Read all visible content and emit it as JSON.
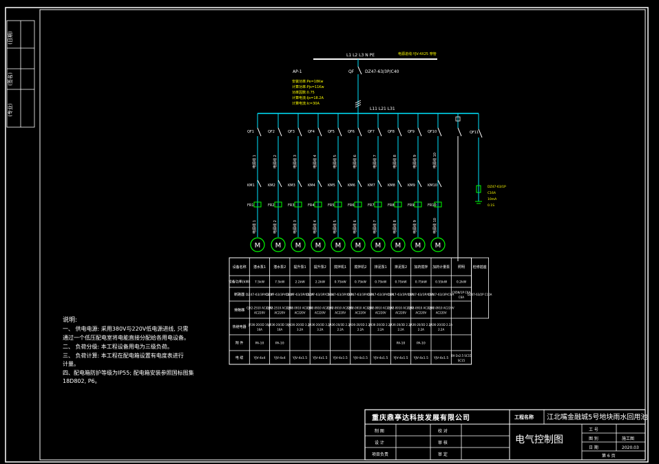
{
  "side_labels": [
    "(日期)",
    "(签名)",
    "(专业)"
  ],
  "bus": {
    "phases": "L1  L2  L3   N  PE",
    "incoming": "电源进线:YJV-4X25 穿管",
    "panel_id": "AP-1",
    "main_breaker_id": "QF",
    "main_breaker": "DZ47-63/3P/C40",
    "params": [
      "安装功率:Pe=18Kw",
      "计算功率:Pjs=11Kw",
      "功率因数:0.75",
      "计算电流:Ijs=18.2A",
      "计算电流:Ic=30A"
    ],
    "sub_phases": "L11  L21  L31"
  },
  "branches": {
    "breakers": [
      "QF1",
      "QF2",
      "QF3",
      "QF4",
      "QF5",
      "QF6",
      "QF7",
      "QF8",
      "QF9",
      "QF10",
      "",
      "QF11"
    ],
    "cables": [
      "电源线 1",
      "电源线 2",
      "电源线 3",
      "电源线 4",
      "电源线 5",
      "电源线 6",
      "电源线 7",
      "电源线 8",
      "电源线 9",
      "电源线 10"
    ],
    "contactors": [
      "KM1",
      "KM2",
      "KM3",
      "KM4",
      "KM5",
      "KM6",
      "KM7",
      "KM8",
      "KM9",
      "KM10"
    ],
    "relays": [
      "FR1",
      "FR2",
      "FR3",
      "FR4",
      "FR5",
      "FR6",
      "FR7",
      "FR8",
      "FR9",
      "FR10"
    ],
    "motor_cables": [
      "电源线 1",
      "电源线 2",
      "电源线 3",
      "电源线 4",
      "电源线 5",
      "电源线 6",
      "电源线 7",
      "电源线 8",
      "电源线 9",
      "电源线 10"
    ],
    "motor_symbol": "M",
    "spare_note": [
      "DZ47-63/1P",
      "C16A",
      "10mA",
      "0.1S"
    ]
  },
  "table": {
    "row_labels": [
      "设备名称",
      "设备功率(kW)",
      "断路器",
      "接触器",
      "热继电器",
      "附 件",
      "电 缆"
    ],
    "last_col_header": "检修插座",
    "columns": [
      {
        "name": "潜水泵1",
        "power": "7.5kW",
        "breaker": "DZ47-63/3P/C20A",
        "contactor": "CJX2-2510 AC220V",
        "relay": "JR36-20/3D 16A",
        "accessory": "PA-10",
        "cable": "YJV-4x4"
      },
      {
        "name": "潜水泵2",
        "power": "7.5kW",
        "breaker": "DZ47-63/3P/C20A",
        "contactor": "CJX2-2510 AC220V",
        "relay": "JR36-20/3D 16A",
        "accessory": "PA-10",
        "cable": "YJV-4x4"
      },
      {
        "name": "提升泵1",
        "power": "2.2kW",
        "breaker": "DZ47-63/3P/C10A",
        "contactor": "CJX2-0910 AC220V",
        "relay": "JR36-20/3D 3.2A",
        "accessory": "",
        "cable": "YJV-4x1.5"
      },
      {
        "name": "提升泵2",
        "power": "2.2kW",
        "breaker": "DZ47-63/3P/C10A",
        "contactor": "CJX2-0910 AC220V",
        "relay": "JR36-20/3D 3.2A",
        "accessory": "",
        "cable": "YJV-4x1.5"
      },
      {
        "name": "搅拌机1",
        "power": "0.75kW",
        "breaker": "DZ47-63/3P/C6A",
        "contactor": "CJX2-0910 AC220V",
        "relay": "JR36-20/3D 2.2A",
        "accessory": "",
        "cable": "YJV-4x1.5"
      },
      {
        "name": "搅拌机2",
        "power": "0.75kW",
        "breaker": "DZ47-63/3P/C6A",
        "contactor": "CJX2-0910 AC220V",
        "relay": "JR36-20/3D 2.2A",
        "accessory": "",
        "cable": "YJV-4x1.5"
      },
      {
        "name": "排泥泵1",
        "power": "0.75kW",
        "breaker": "DZ47-63/3P/C6A",
        "contactor": "CJX2-0910 AC220V",
        "relay": "JR36-20/3D 2.2A",
        "accessory": "",
        "cable": "YJV-4x1.5"
      },
      {
        "name": "排泥泵2",
        "power": "0.75kW",
        "breaker": "DZ47-63/3P/C6A",
        "contactor": "CJX2-0910 AC220V",
        "relay": "JR36-20/3D 2.2A",
        "accessory": "PA-10",
        "cable": "YJV-4x1.5"
      },
      {
        "name": "加药搅拌",
        "power": "0.75kW",
        "breaker": "DZ47-63/3P/C6A",
        "contactor": "CJX2-0910 AC220V",
        "relay": "JR36-20/3D 2.2A",
        "accessory": "PA-10",
        "cable": "YJV-4x1.5"
      },
      {
        "name": "加药计量泵",
        "power": "0.55kW",
        "breaker": "DZ47-63/3P/C6A",
        "contactor": "CJX2-0910 AC220V",
        "relay": "JR36-20/3D 2.2A",
        "accessory": "",
        "cable": "YJV-4x1.5"
      },
      {
        "name": "照明",
        "power": "0.2kW",
        "breaker": "C65N/1P C6A",
        "contactor": "",
        "relay": "",
        "accessory": "",
        "cable": "BV-2x2.5 SC15"
      }
    ],
    "last_col_breaker": "DZ47-63/2P C16A"
  },
  "notes": {
    "title": "说明:",
    "lines": [
      "一、  供电电源: 采用380V与220V低电源进线, 只需",
      "通过一个低压配电室将电能直接分配给各用电设备。",
      "二、  负荷分级: 本工程设备用电为三级负荷。",
      "三、  负荷计算: 本工程在配电箱设置有电度表进行",
      "计量。",
      "四、配电箱防护等级为IP55; 配电箱安装参照国标图集",
      "18D802, P6。"
    ]
  },
  "title_block": {
    "company": "重庆鼎亭达科技发展有限公司",
    "project_label": "工程名称",
    "project": "江北嘴金融城5号地块雨水回用池",
    "drawing_name": "电气控制图",
    "left_rows": [
      "制 图",
      "设 计",
      "项目负责"
    ],
    "mid_rows": [
      "校 对",
      "审 核",
      "审 定"
    ],
    "right_rows": [
      [
        "工 号",
        ""
      ],
      [
        "图 别",
        "施工图"
      ],
      [
        "日 期",
        "2020.03"
      ]
    ],
    "sheet": "第 6 页"
  },
  "colors": {
    "line": "#ffffff",
    "bus": "#00e5ff",
    "breaker": "#00ff00",
    "label": "#ffff00"
  }
}
